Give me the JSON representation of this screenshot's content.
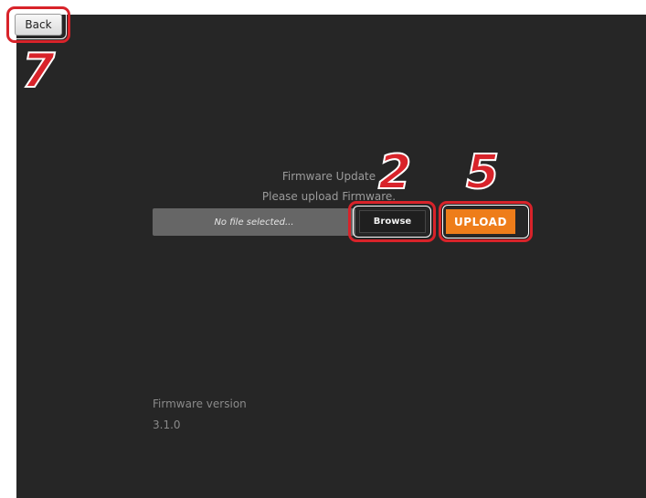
{
  "header": {
    "back_label": "Back"
  },
  "main": {
    "title": "Firmware Update",
    "subtitle": "Please upload Firmware.",
    "file_input": {
      "value": "No file selected..."
    },
    "browse_label": "Browse",
    "upload_label": "UPLOAD"
  },
  "footer": {
    "version_label": "Firmware version",
    "version_value": "3.1.0"
  },
  "callouts": {
    "back": "7",
    "browse": "2",
    "upload": "5"
  },
  "colors": {
    "background": "#262626",
    "accent": "#ee7d1a",
    "callout": "#d8232a"
  }
}
